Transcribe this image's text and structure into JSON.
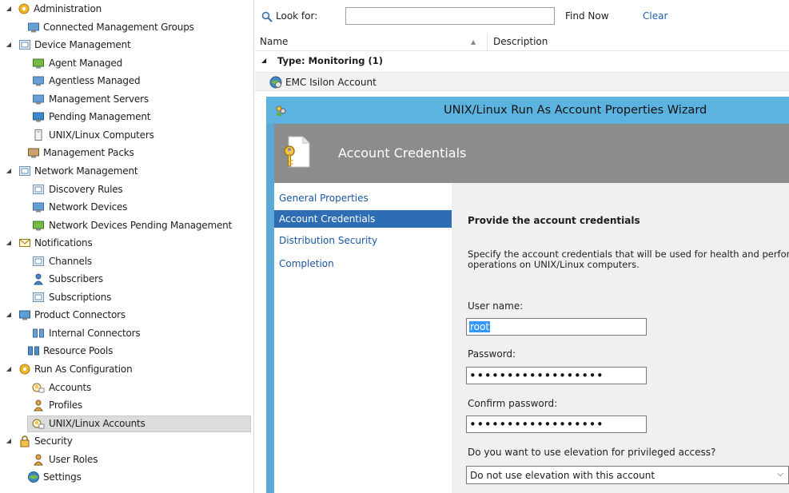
{
  "tree": [
    {
      "id": "administration",
      "label": "Administration",
      "level": 0,
      "twisty": "expanded",
      "icon": "gear-icon"
    },
    {
      "id": "connected-management-groups",
      "label": "Connected Management Groups",
      "level": 1,
      "icon": "connected-groups-icon"
    },
    {
      "id": "device-management",
      "label": "Device Management",
      "level": 0.5,
      "twisty": "expanded",
      "icon": "device-management-icon"
    },
    {
      "id": "agent-managed",
      "label": "Agent Managed",
      "level": 2,
      "icon": "agent-managed-icon"
    },
    {
      "id": "agentless-managed",
      "label": "Agentless Managed",
      "level": 2,
      "icon": "agentless-managed-icon"
    },
    {
      "id": "management-servers",
      "label": "Management Servers",
      "level": 2,
      "icon": "management-servers-icon"
    },
    {
      "id": "pending-management",
      "label": "Pending Management",
      "level": 2,
      "icon": "pending-management-icon"
    },
    {
      "id": "unix-linux-computers",
      "label": "UNIX/Linux Computers",
      "level": 2,
      "icon": "unix-computers-icon"
    },
    {
      "id": "management-packs",
      "label": "Management Packs",
      "level": 1,
      "icon": "management-packs-icon"
    },
    {
      "id": "network-management",
      "label": "Network Management",
      "level": 0.5,
      "twisty": "expanded",
      "icon": "network-management-icon"
    },
    {
      "id": "discovery-rules",
      "label": "Discovery Rules",
      "level": 2,
      "icon": "discovery-rules-icon"
    },
    {
      "id": "network-devices",
      "label": "Network Devices",
      "level": 2,
      "icon": "network-devices-icon"
    },
    {
      "id": "network-devices-pending",
      "label": "Network Devices Pending Management",
      "level": 2,
      "icon": "network-pending-icon"
    },
    {
      "id": "notifications",
      "label": "Notifications",
      "level": 0.5,
      "twisty": "expanded",
      "icon": "envelope-icon"
    },
    {
      "id": "channels",
      "label": "Channels",
      "level": 2,
      "icon": "channels-icon"
    },
    {
      "id": "subscribers",
      "label": "Subscribers",
      "level": 2,
      "icon": "subscribers-icon"
    },
    {
      "id": "subscriptions",
      "label": "Subscriptions",
      "level": 2,
      "icon": "subscriptions-icon"
    },
    {
      "id": "product-connectors",
      "label": "Product Connectors",
      "level": 0.5,
      "twisty": "expanded",
      "icon": "product-connectors-icon"
    },
    {
      "id": "internal-connectors",
      "label": "Internal Connectors",
      "level": 2,
      "icon": "internal-connectors-icon"
    },
    {
      "id": "resource-pools",
      "label": "Resource Pools",
      "level": 1,
      "icon": "resource-pools-icon"
    },
    {
      "id": "run-as-configuration",
      "label": "Run As Configuration",
      "level": 0.5,
      "twisty": "expanded",
      "icon": "run-as-icon"
    },
    {
      "id": "accounts",
      "label": "Accounts",
      "level": 2,
      "icon": "accounts-icon"
    },
    {
      "id": "profiles",
      "label": "Profiles",
      "level": 2,
      "icon": "profiles-icon"
    },
    {
      "id": "unix-linux-accounts",
      "label": "UNIX/Linux Accounts",
      "level": 2,
      "icon": "unix-accounts-icon",
      "selected": true
    },
    {
      "id": "security",
      "label": "Security",
      "level": 0.5,
      "twisty": "expanded",
      "icon": "lock-icon"
    },
    {
      "id": "user-roles",
      "label": "User Roles",
      "level": 2,
      "icon": "user-roles-icon"
    },
    {
      "id": "settings",
      "label": "Settings",
      "level": 1,
      "icon": "settings-icon"
    }
  ],
  "toolbar": {
    "look_for_label": "Look for:",
    "search_value": "",
    "find_now_label": "Find Now",
    "clear_label": "Clear"
  },
  "list": {
    "col_name": "Name",
    "col_description": "Description",
    "group_label": "Type: Monitoring (1)",
    "item_label": "EMC Isilon Account"
  },
  "wizard": {
    "title": "UNIX/Linux Run As Account Properties Wizard",
    "banner_title": "Account Credentials",
    "steps": [
      "General Properties",
      "Account Credentials",
      "Distribution Security",
      "Completion"
    ],
    "active_step": 1,
    "heading": "Provide the account credentials",
    "description_line1": "Specify the account credentials that will be used for health and performa",
    "description_line2": "operations on UNIX/Linux computers.",
    "username_label": "User name:",
    "username_value": "root",
    "password_label": "Password:",
    "password_value": "••••••••••••••••••",
    "confirm_label": "Confirm password:",
    "confirm_value": "••••••••••••••••••",
    "elevation_question": "Do you want to use elevation for privileged access?",
    "elevation_selected": "Do not use elevation with this account"
  },
  "colors": {
    "wizard_title_bar": "#5cb3df",
    "wizard_banner": "#8c8c8c",
    "active_step": "#2e6db4",
    "link": "#1f5fae"
  }
}
